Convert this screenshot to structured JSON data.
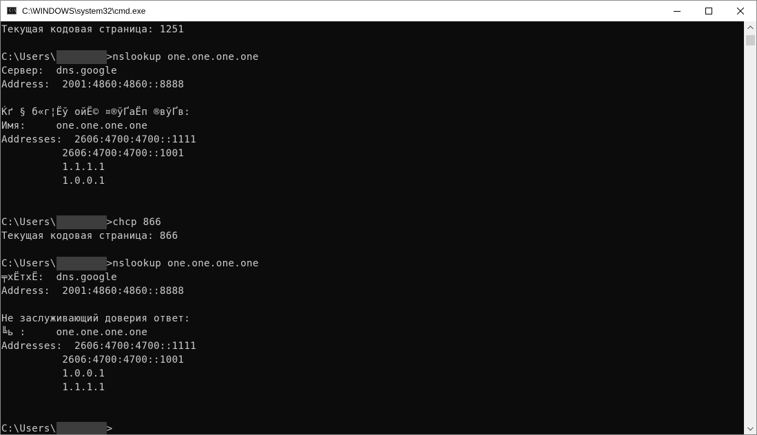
{
  "window": {
    "title": "C:\\WINDOWS\\system32\\cmd.exe",
    "icon_glyph": "C:\\"
  },
  "caption_buttons": {
    "minimize_icon": "minimize-icon",
    "maximize_icon": "maximize-icon",
    "close_icon": "close-icon"
  },
  "console": {
    "lines": [
      "Текущая кодовая страница: 1251",
      "",
      "C:\\Users\\",
      "Сервер:  dns.google",
      "Address:  2001:4860:4860::8888",
      "",
      "Ќґ § б«г¦Ёў ойЁ© ¤®ўҐаЁп ®вўҐв:",
      "Имя:     one.one.one.one",
      "Addresses:  2606:4700:4700::1111",
      "          2606:4700:4700::1001",
      "          1.1.1.1",
      "          1.0.0.1",
      "",
      "",
      "C:\\Users\\",
      "Текущая кодовая страница: 866",
      "",
      "C:\\Users\\",
      "╤хЁтхЁ:  dns.google",
      "Address:  2001:4860:4860::8888",
      "",
      "Не заслуживающий доверия ответ:",
      "╚ь :     one.one.one.one",
      "Addresses:  2606:4700:4700::1111",
      "          2606:4700:4700::1001",
      "          1.0.0.1",
      "          1.1.1.1",
      "",
      "",
      "C:\\Users\\"
    ],
    "prompt_suffixes": {
      "2": ">nslookup one.one.one.one",
      "14": ">chcp 866",
      "17": ">nslookup one.one.one.one",
      "29": ">"
    }
  },
  "colors": {
    "console_background": "#0c0c0c",
    "console_text": "#cccccc",
    "redaction_block": "#3d3d3d",
    "titlebar_background": "#ffffff"
  }
}
